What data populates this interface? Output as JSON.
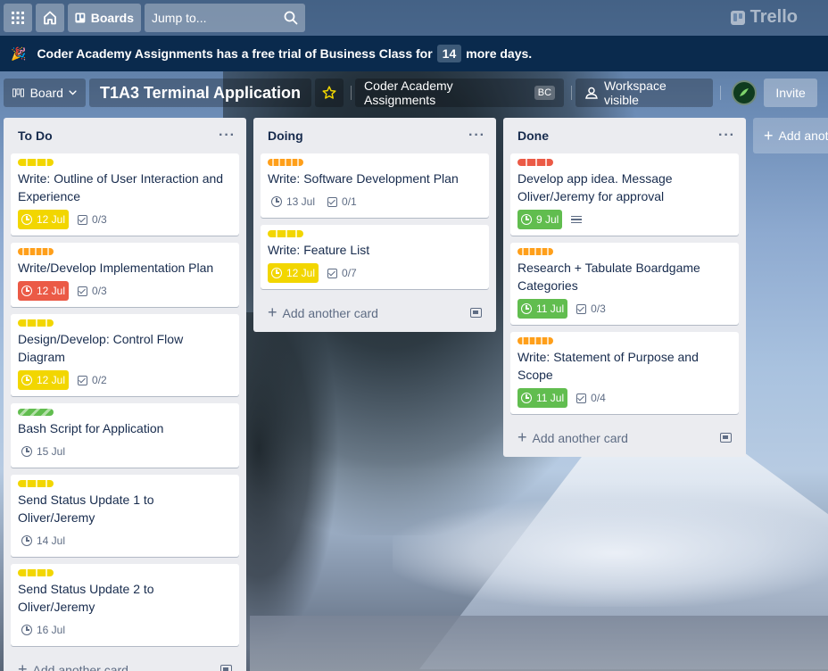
{
  "topnav": {
    "boards_label": "Boards",
    "search_placeholder": "Jump to...",
    "logo_text": "Trello"
  },
  "banner": {
    "text_before": "Coder Academy Assignments has a free trial of Business Class for",
    "days": "14",
    "text_after": "more days."
  },
  "board": {
    "view_label": "Board",
    "title": "T1A3 Terminal Application",
    "workspace_name": "Coder Academy Assignments",
    "workspace_badge": "BC",
    "visibility_label": "Workspace visible",
    "invite_label": "Invite",
    "add_list_label": "Add anot"
  },
  "colors": {
    "label_yellow": "#f2d600",
    "label_orange": "#ff9f1a",
    "label_red": "#eb5a46",
    "label_green": "#61bd4f",
    "banner_bg": "#0a2a4d"
  },
  "lists": [
    {
      "title": "To Do",
      "add_card_label": "Add another card",
      "cards": [
        {
          "title": "Write: Outline of User Interaction and Experience",
          "label": "yellow",
          "due": "12 Jul",
          "due_state": "yellow",
          "checklist": "0/3"
        },
        {
          "title": "Write/Develop Implementation Plan",
          "label": "orange",
          "due": "12 Jul",
          "due_state": "red",
          "checklist": "0/3"
        },
        {
          "title": "Design/Develop: Control Flow Diagram",
          "label": "yellow",
          "due": "12 Jul",
          "due_state": "yellow",
          "checklist": "0/2"
        },
        {
          "title": "Bash Script for Application",
          "label": "green",
          "due": "15 Jul",
          "due_state": "none"
        },
        {
          "title": "Send Status Update 1 to Oliver/Jeremy",
          "label": "yellow",
          "due": "14 Jul",
          "due_state": "none"
        },
        {
          "title": "Send Status Update 2 to Oliver/Jeremy",
          "label": "yellow",
          "due": "16 Jul",
          "due_state": "none"
        }
      ]
    },
    {
      "title": "Doing",
      "add_card_label": "Add another card",
      "cards": [
        {
          "title": "Write: Software Development Plan",
          "label": "orange",
          "due": "13 Jul",
          "due_state": "none",
          "checklist": "0/1"
        },
        {
          "title": "Write: Feature List",
          "label": "yellow",
          "due": "12 Jul",
          "due_state": "yellow",
          "checklist": "0/7"
        }
      ]
    },
    {
      "title": "Done",
      "add_card_label": "Add another card",
      "cards": [
        {
          "title": "Develop app idea. Message Oliver/Jeremy for approval",
          "label": "red",
          "due": "9 Jul",
          "due_state": "green",
          "has_description": true
        },
        {
          "title": "Research + Tabulate Boardgame Categories",
          "label": "orange",
          "due": "11 Jul",
          "due_state": "green",
          "checklist": "0/3"
        },
        {
          "title": "Write: Statement of Purpose and Scope",
          "label": "orange",
          "due": "11 Jul",
          "due_state": "green",
          "checklist": "0/4"
        }
      ]
    }
  ]
}
